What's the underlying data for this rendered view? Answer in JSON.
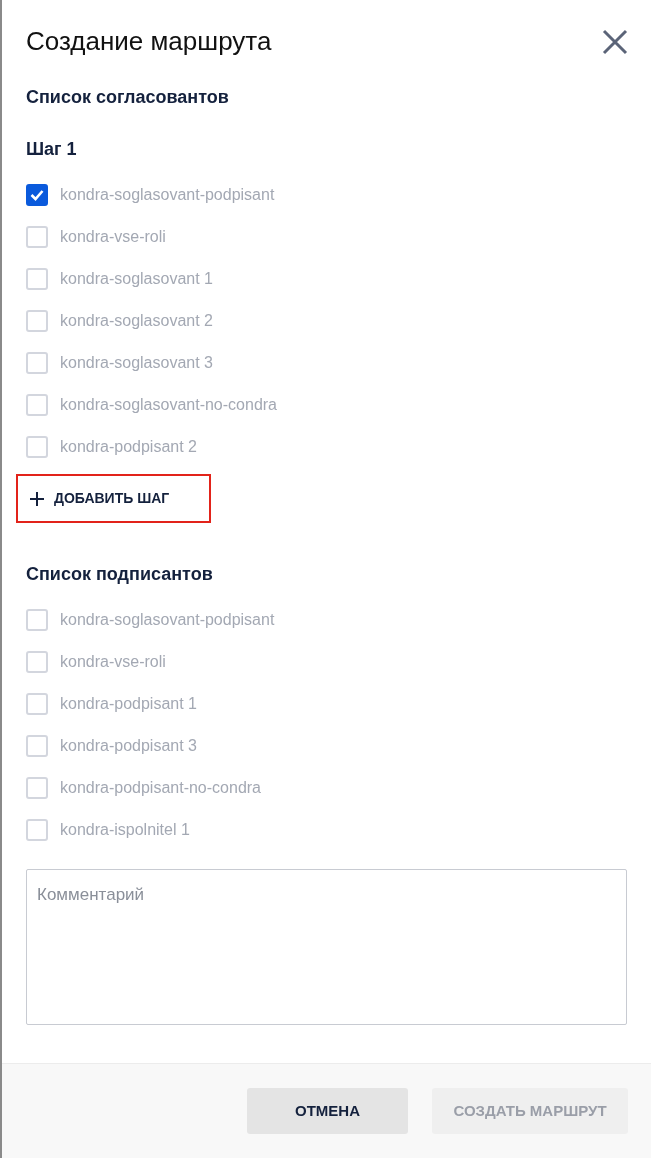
{
  "dialog": {
    "title": "Создание маршрута"
  },
  "approvers": {
    "heading": "Список согласовантов",
    "steps": [
      {
        "title": "Шаг 1",
        "options": [
          {
            "label": "kondra-soglasovant-podpisant",
            "checked": true
          },
          {
            "label": "kondra-vse-roli",
            "checked": false
          },
          {
            "label": "kondra-soglasovant 1",
            "checked": false
          },
          {
            "label": "kondra-soglasovant 2",
            "checked": false
          },
          {
            "label": "kondra-soglasovant 3",
            "checked": false
          },
          {
            "label": "kondra-soglasovant-no-condra",
            "checked": false
          },
          {
            "label": "kondra-podpisant 2",
            "checked": false
          }
        ]
      }
    ],
    "add_step_button": {
      "label": "ДОБАВИТЬ ШАГ",
      "highlighted": true
    }
  },
  "signers": {
    "heading": "Список подписантов",
    "options": [
      {
        "label": "kondra-soglasovant-podpisant",
        "checked": false
      },
      {
        "label": "kondra-vse-roli",
        "checked": false
      },
      {
        "label": "kondra-podpisant 1",
        "checked": false
      },
      {
        "label": "kondra-podpisant 3",
        "checked": false
      },
      {
        "label": "kondra-podpisant-no-condra",
        "checked": false
      },
      {
        "label": "kondra-ispolnitel 1",
        "checked": false
      }
    ]
  },
  "comment": {
    "placeholder": "Комментарий"
  },
  "footer": {
    "buttons": [
      {
        "label": "ОТМЕНА",
        "disabled": false
      },
      {
        "label": "СОЗДАТЬ МАРШРУТ",
        "disabled": true
      }
    ]
  }
}
